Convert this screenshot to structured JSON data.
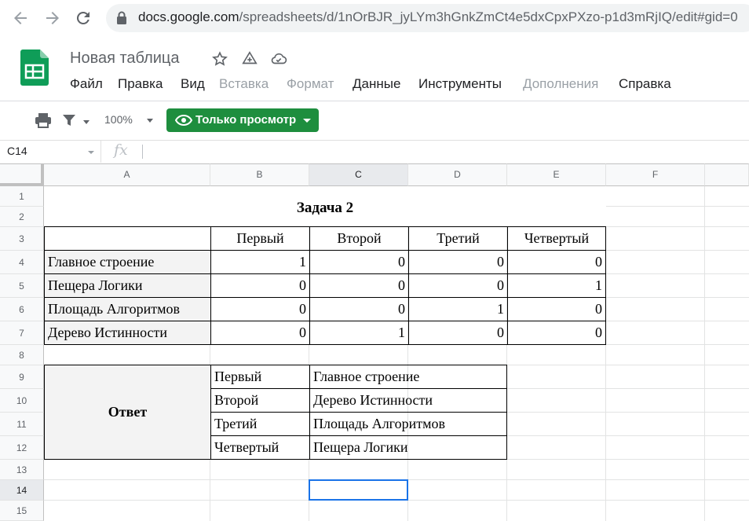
{
  "browser": {
    "url_main": "docs.google.com",
    "url_path": "/spreadsheets/d/1nOrBJR_jyLYm3hGnkZmCt4e5dxCpxPXzo-p1d3mRjIQ/edit#gid=0"
  },
  "app": {
    "title": "Новая таблица",
    "menu": [
      {
        "label": "Файл",
        "enabled": true
      },
      {
        "label": "Правка",
        "enabled": true
      },
      {
        "label": "Вид",
        "enabled": true
      },
      {
        "label": "Вставка",
        "enabled": false
      },
      {
        "label": "Формат",
        "enabled": false
      },
      {
        "label": "Данные",
        "enabled": true
      },
      {
        "label": "Инструменты",
        "enabled": true
      },
      {
        "label": "Дополнения",
        "enabled": false
      },
      {
        "label": "Справка",
        "enabled": true
      }
    ]
  },
  "toolbar": {
    "zoom": "100%",
    "view_only_label": "Только просмотр"
  },
  "formula_bar": {
    "name_box": "C14",
    "fx": "fx"
  },
  "sheet": {
    "columns": [
      "A",
      "B",
      "C",
      "D",
      "E",
      "F"
    ],
    "selected_column": "C",
    "rows": [
      "1",
      "2",
      "3",
      "4",
      "5",
      "6",
      "7",
      "8",
      "9",
      "10",
      "11",
      "12",
      "13",
      "14",
      "15"
    ],
    "selected_row": "14",
    "selected_cell": "C14",
    "title": "Задача 2",
    "table_headers": [
      "Первый",
      "Второй",
      "Третий",
      "Четвертый"
    ],
    "table_rows": [
      {
        "label": "Главное строение",
        "values": [
          "1",
          "0",
          "0",
          "0"
        ]
      },
      {
        "label": "Пещера Логики",
        "values": [
          "0",
          "0",
          "0",
          "1"
        ]
      },
      {
        "label": "Площадь Алгоритмов",
        "values": [
          "0",
          "0",
          "1",
          "0"
        ]
      },
      {
        "label": "Дерево Истинности",
        "values": [
          "0",
          "1",
          "0",
          "0"
        ]
      }
    ],
    "answer_label": "Ответ",
    "answer_rows": [
      {
        "place": "Первый",
        "location": "Главное строение"
      },
      {
        "place": "Второй",
        "location": "Дерево Истинности"
      },
      {
        "place": "Третий",
        "location": "Площадь Алгоритмов"
      },
      {
        "place": "Четвертый",
        "location": "Пещера Логики"
      }
    ]
  },
  "colors": {
    "view_button": "#1e8e3e",
    "selection": "#1a73e8",
    "sheets_green": "#0f9d58"
  }
}
